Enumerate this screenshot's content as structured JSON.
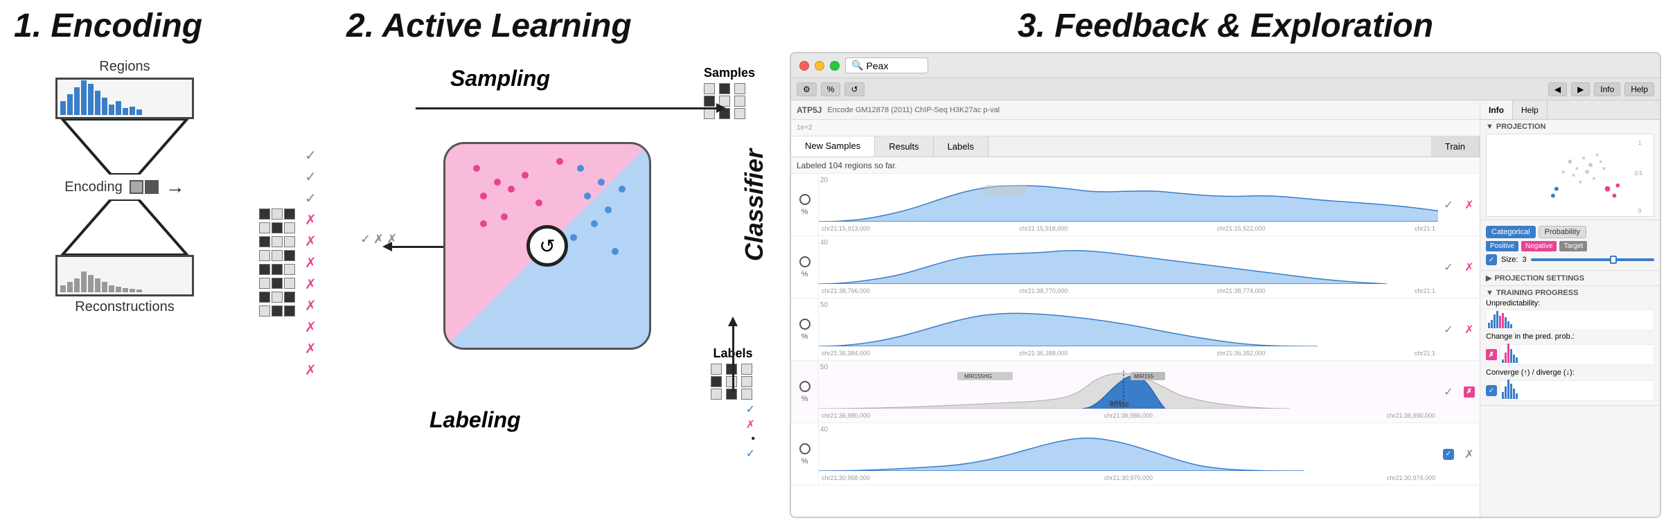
{
  "section1": {
    "title": "1. Encoding",
    "label_regions": "Regions",
    "label_encoding": "Encoding",
    "label_reconstructions": "Reconstructions"
  },
  "section2": {
    "title": "2. Active Learning",
    "label_sampling": "Sampling",
    "label_samples": "Samples",
    "label_classifier": "Classifier",
    "label_labeling": "Labeling",
    "label_labels": "Labels"
  },
  "section3": {
    "title": "3. Feedback & Exploration",
    "window_search": "Peax",
    "toolbar": {
      "info_btn": "Info",
      "help_btn": "Help"
    },
    "tabs": {
      "new_samples": "New Samples",
      "results": "Results",
      "labels": "Labels",
      "train": "Train"
    },
    "labeled_info": "Labeled 104 regions so far.",
    "track_header": "ATP5J",
    "track_encode": "Encode GM12878 (2011) ChIP-Seq H3K27ac p-val",
    "panel": {
      "info_tab": "Info",
      "help_tab": "Help",
      "projection_title": "PROJECTION",
      "proj_settings": "PROJECTION SETTINGS",
      "training_progress": "TRAINING PROGRESS",
      "unpredictability": "Unpredictability:",
      "change_pred": "Change in the pred. prob.:",
      "converge": "Converge (↑) / diverge (↓):",
      "categorical": "Categorical",
      "probability": "Probability",
      "positive": "Positive",
      "negative": "Negative",
      "target": "Target",
      "size_label": "Size:",
      "size_value": "3"
    }
  }
}
